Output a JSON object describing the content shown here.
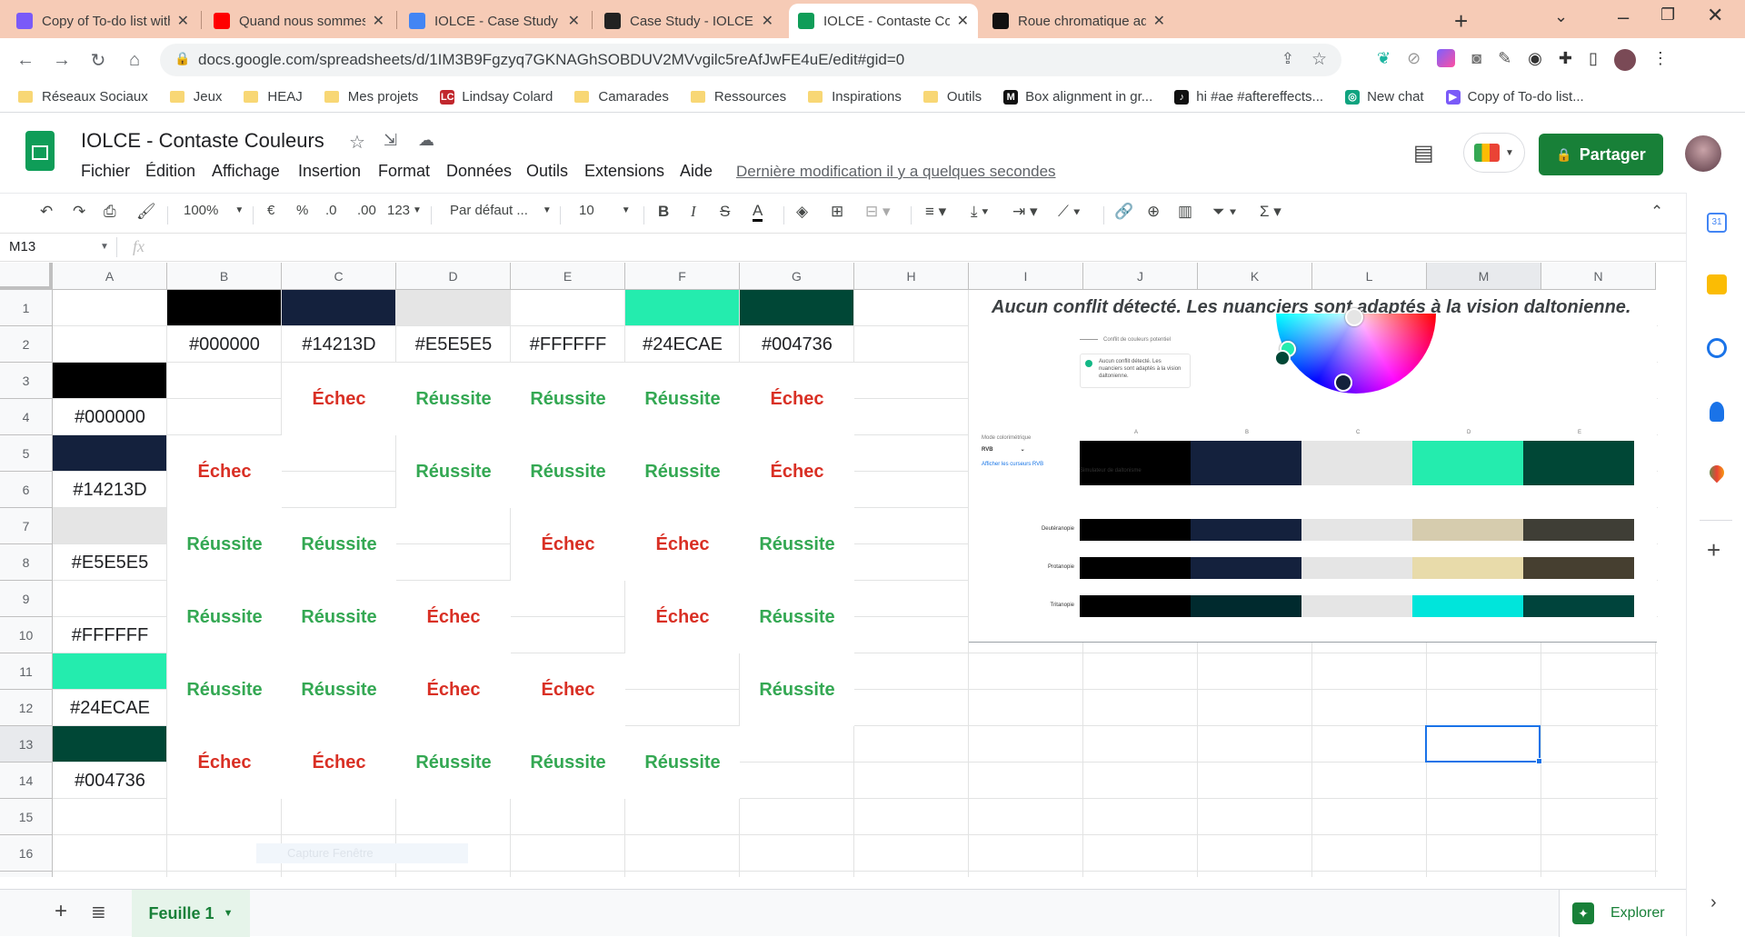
{
  "browser": {
    "tabs": [
      {
        "label": "Copy of To-do list with prog",
        "favicon": "bookmark-icon",
        "color": "#7a5af8"
      },
      {
        "label": "Quand nous sommes tous c",
        "favicon": "youtube-icon",
        "color": "#ff0000"
      },
      {
        "label": "IOLCE - Case Study - Googl",
        "favicon": "google-docs-icon",
        "color": "#4285f4"
      },
      {
        "label": "Case Study - IOLCE - Lindsa",
        "favicon": "cargo-icon",
        "color": "#222222"
      },
      {
        "label": "IOLCE - Contaste Couleurs",
        "favicon": "google-sheets-icon",
        "color": "#0f9d58"
      },
      {
        "label": "Roue chromatique adaptée",
        "favicon": "adobe-color-icon",
        "color": "#111111"
      }
    ],
    "url": "docs.google.com/spreadsheets/d/1IM3B9Fgzyq7GKNAGhSOBDUV2MVvgilc5reAfJwFE4uE/edit#gid=0",
    "bookmarks": [
      "Réseaux Sociaux",
      "Jeux",
      "HEAJ",
      "Mes projets",
      "Lindsay Colard",
      "Camarades",
      "Ressources",
      "Inspirations",
      "Outils",
      "Box alignment in gr...",
      "hi #ae #aftereffects...",
      "New chat",
      "Copy of To-do list..."
    ]
  },
  "doc": {
    "title": "IOLCE - Contaste Couleurs",
    "menu": [
      "Fichier",
      "Édition",
      "Affichage",
      "Insertion",
      "Format",
      "Données",
      "Outils",
      "Extensions",
      "Aide"
    ],
    "last_edit": "Dernière modification il y a quelques secondes",
    "share_label": "Partager"
  },
  "toolbar": {
    "zoom": "100%",
    "currency": "€",
    "percent": "%",
    "dec_less": ".0",
    "dec_more": ".00",
    "number_format": "123",
    "font": "Par défaut ...",
    "font_size": "10"
  },
  "formula": {
    "name_box": "M13",
    "fx": "fx"
  },
  "sheet": {
    "columns": [
      "A",
      "B",
      "C",
      "D",
      "E",
      "F",
      "G",
      "H",
      "I",
      "J",
      "K",
      "L",
      "M",
      "N"
    ],
    "rows": [
      "1",
      "2",
      "3",
      "4",
      "5",
      "6",
      "7",
      "8",
      "9",
      "10",
      "11",
      "12",
      "13",
      "14",
      "15",
      "16",
      "17"
    ],
    "colors": [
      "#000000",
      "#14213D",
      "#E5E5E5",
      "#FFFFFF",
      "#24ECAE",
      "#004736"
    ],
    "header_hex": [
      "#000000",
      "#14213D",
      "#E5E5E5",
      "#FFFFFF",
      "#24ECAE",
      "#004736"
    ],
    "row_hex": [
      "#000000",
      "#14213D",
      "#E5E5E5",
      "#FFFFFF",
      "#24ECAE",
      "#004736"
    ],
    "results": [
      [
        "",
        "Échec",
        "Réussite",
        "Réussite",
        "Réussite",
        "Échec"
      ],
      [
        "Échec",
        "",
        "Réussite",
        "Réussite",
        "Réussite",
        "Échec"
      ],
      [
        "Réussite",
        "Réussite",
        "",
        "Échec",
        "Échec",
        "Réussite"
      ],
      [
        "Réussite",
        "Réussite",
        "Échec",
        "",
        "Échec",
        "Réussite"
      ],
      [
        "Réussite",
        "Réussite",
        "Échec",
        "Échec",
        "",
        "Réussite"
      ],
      [
        "Échec",
        "Échec",
        "Réussite",
        "Réussite",
        "Réussite",
        ""
      ]
    ],
    "fail_color": "#d93025",
    "success_color": "#34a853",
    "ghost_text": "Capture Fenêtre"
  },
  "embed": {
    "title": "Aucun conflit détecté. Les nuanciers sont adaptés à la vision daltonienne.",
    "conflict_label": "Conflit de couleurs potentiel",
    "note": "Aucun conflit détecté. Les nuanciers sont adaptés à la vision daltonienne.",
    "mode_label": "Mode colorimétrique",
    "mode_value": "RVB",
    "rgb_link": "Afficher les curseurs RVB",
    "swatch_letters": [
      "A",
      "B",
      "C",
      "D",
      "E"
    ],
    "simulator_label": "Simulateur de daltonisme",
    "palette": [
      "#000000",
      "#14213D",
      "#E5E5E5",
      "#24ECAE",
      "#004736"
    ],
    "simulations": [
      {
        "name": "Deutéranopie",
        "colors": [
          "#000000",
          "#14213D",
          "#E5E5E5",
          "#D6CCAE",
          "#3F3E36"
        ]
      },
      {
        "name": "Protanopie",
        "colors": [
          "#000000",
          "#14213D",
          "#E5E5E5",
          "#E8DBAA",
          "#463F30"
        ]
      },
      {
        "name": "Tritanopie",
        "colors": [
          "#000000",
          "#002A2E",
          "#E5E5E5",
          "#00E5DB",
          "#00443C"
        ]
      }
    ]
  },
  "bottom": {
    "sheet_name": "Feuille 1",
    "explore": "Explorer"
  }
}
